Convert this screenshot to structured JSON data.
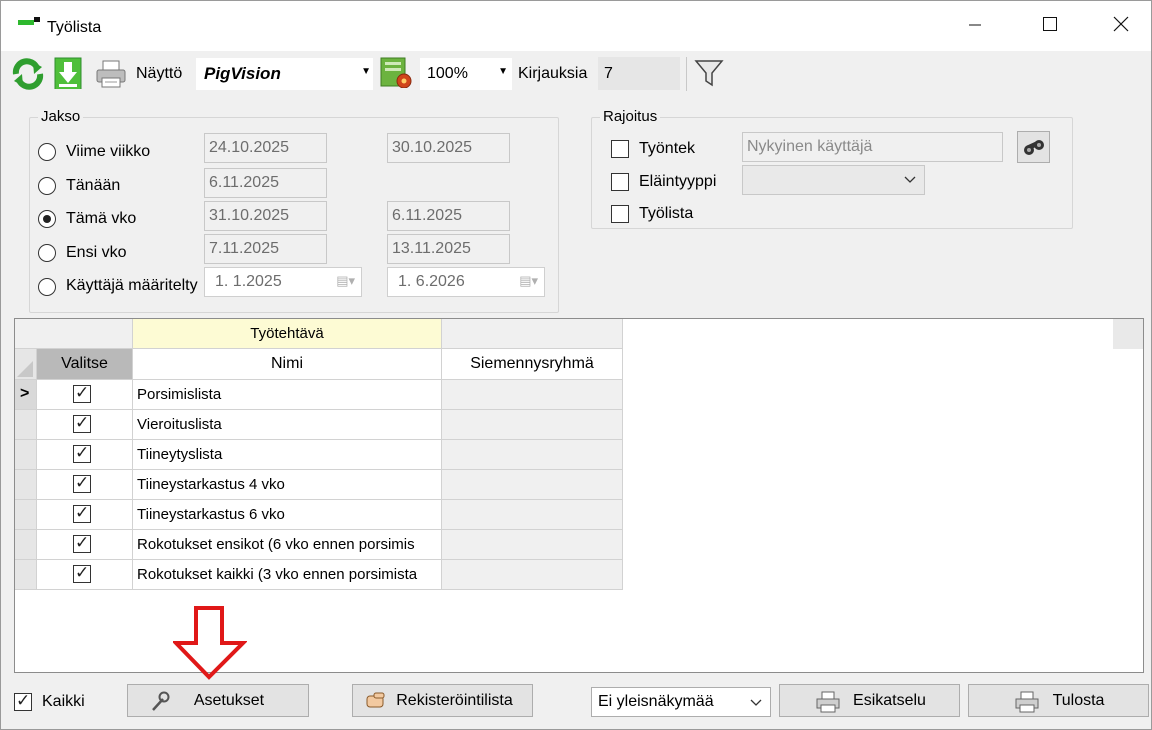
{
  "window": {
    "title": "Työlista",
    "minimize_icon": "minimize-icon",
    "maximize_icon": "maximize-icon",
    "close_icon": "close-icon"
  },
  "toolbar": {
    "refresh_icon": "refresh-icon",
    "download_icon": "download-arrow-icon",
    "print_icon": "printer-icon",
    "view_label": "Näyttö",
    "view_value": "PigVision",
    "report_settings_icon": "report-settings-icon",
    "zoom_value": "100%",
    "records_label": "Kirjauksia",
    "records_count": "7",
    "filter_icon": "filter-funnel-icon"
  },
  "period": {
    "title": "Jakso",
    "options": [
      {
        "label": "Viime viikko",
        "from": "24.10.2025",
        "to": "30.10.2025",
        "selected": false
      },
      {
        "label": "Tänään",
        "from": "6.11.2025",
        "to": "",
        "selected": false
      },
      {
        "label": "Tämä vko",
        "from": "31.10.2025",
        "to": "6.11.2025",
        "selected": true
      },
      {
        "label": "Ensi vko",
        "from": "7.11.2025",
        "to": "13.11.2025",
        "selected": false
      },
      {
        "label": "Käyttäjä määritelty",
        "from": "1.  1.2025",
        "to": "1.  6.2026",
        "selected": false
      }
    ]
  },
  "restriction": {
    "title": "Rajoitus",
    "employee_label": "Työntek",
    "employee_value": "Nykyinen käyttäjä",
    "animal_type_label": "Eläintyyppi",
    "animal_type_value": "",
    "worklist_label": "Työlista",
    "employee_checked": false,
    "animal_type_checked": false,
    "worklist_checked": false,
    "binoculars_icon": "binoculars-icon"
  },
  "grid": {
    "group_header": "Työtehtävä",
    "columns": [
      "Valitse",
      "Nimi",
      "Siemennysryhmä"
    ],
    "rows": [
      {
        "selected": true,
        "name": "Porsimislista",
        "group": ""
      },
      {
        "selected": true,
        "name": "Vieroituslista",
        "group": ""
      },
      {
        "selected": true,
        "name": "Tiineytyslista",
        "group": ""
      },
      {
        "selected": true,
        "name": "Tiineystarkastus 4 vko",
        "group": ""
      },
      {
        "selected": true,
        "name": "Tiineystarkastus 6 vko",
        "group": ""
      },
      {
        "selected": true,
        "name": "Rokotukset ensikot (6 vko ennen porsimis",
        "group": ""
      },
      {
        "selected": true,
        "name": "Rokotukset kaikki (3 vko ennen porsimista",
        "group": ""
      }
    ],
    "current_row_marker": ">"
  },
  "footer": {
    "all_label": "Kaikki",
    "all_checked": true,
    "settings_button": "Asetukset",
    "register_button": "Rekisteröintilista",
    "overview_value": "Ei yleisnäkymää",
    "preview_button": "Esikatselu",
    "print_button": "Tulosta",
    "annotation_arrow": "down-arrow-annotation-icon"
  }
}
